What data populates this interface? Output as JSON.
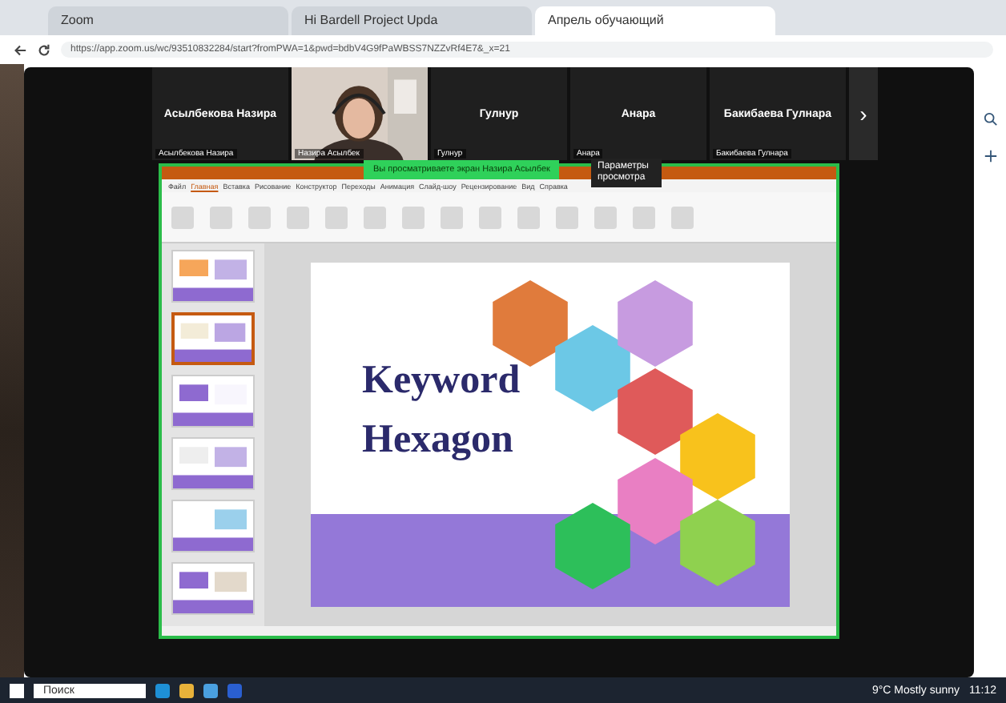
{
  "browser": {
    "tabs": [
      {
        "label": "Zoom",
        "selected": false
      },
      {
        "label": "Hi Bardell Project Upda",
        "selected": false
      },
      {
        "label": "Апрель обучающий",
        "selected": true
      }
    ],
    "address": "https://app.zoom.us/wc/93510832284/start?fromPWA=1&pwd=bdbV4G9fPaWBSS7NZZvRf4E7&_x=21"
  },
  "participants": [
    {
      "name": "Асылбекова Назира",
      "caption": "Асылбекова Назира",
      "kind": "name"
    },
    {
      "caption": "Назира Асылбек",
      "kind": "video"
    },
    {
      "name": "Гулнур",
      "caption": "Гулнур",
      "kind": "name"
    },
    {
      "name": "Анара",
      "caption": "Анара",
      "kind": "name"
    },
    {
      "name": "Бакибаева Гулнара",
      "caption": "Бакибаева Гулнара",
      "kind": "name"
    }
  ],
  "next_page": "›",
  "share_banner": "Вы просматриваете экран Назира Асылбек",
  "view_options": "Параметры просмотра",
  "powerpoint": {
    "ribbon_tabs": [
      {
        "label": "Файл",
        "selected": false
      },
      {
        "label": "Главная",
        "selected": true
      },
      {
        "label": "Вставка",
        "selected": false
      },
      {
        "label": "Рисование",
        "selected": false
      },
      {
        "label": "Конструктор",
        "selected": false
      },
      {
        "label": "Переходы",
        "selected": false
      },
      {
        "label": "Анимация",
        "selected": false
      },
      {
        "label": "Слайд-шоу",
        "selected": false
      },
      {
        "label": "Рецензирование",
        "selected": false
      },
      {
        "label": "Вид",
        "selected": false
      },
      {
        "label": "Справка",
        "selected": false
      }
    ],
    "thumbnails": [
      {
        "selected": false
      },
      {
        "selected": true
      },
      {
        "selected": false
      },
      {
        "selected": false
      },
      {
        "selected": false
      },
      {
        "selected": false
      }
    ],
    "slide": {
      "title_lines": [
        "Keyword",
        "Hexagon"
      ],
      "hexagons": [
        {
          "color": "#e07b3c"
        },
        {
          "color": "#6cc8e6"
        },
        {
          "color": "#c79be0"
        },
        {
          "color": "#df5a5a"
        },
        {
          "color": "#f8c21c"
        },
        {
          "color": "#e97fc3"
        },
        {
          "color": "#2dbf5a"
        },
        {
          "color": "#8fd14f"
        }
      ]
    }
  },
  "taskbar": {
    "search": "Поиск",
    "weather": "9°C Mostly sunny",
    "time": "11:12"
  }
}
